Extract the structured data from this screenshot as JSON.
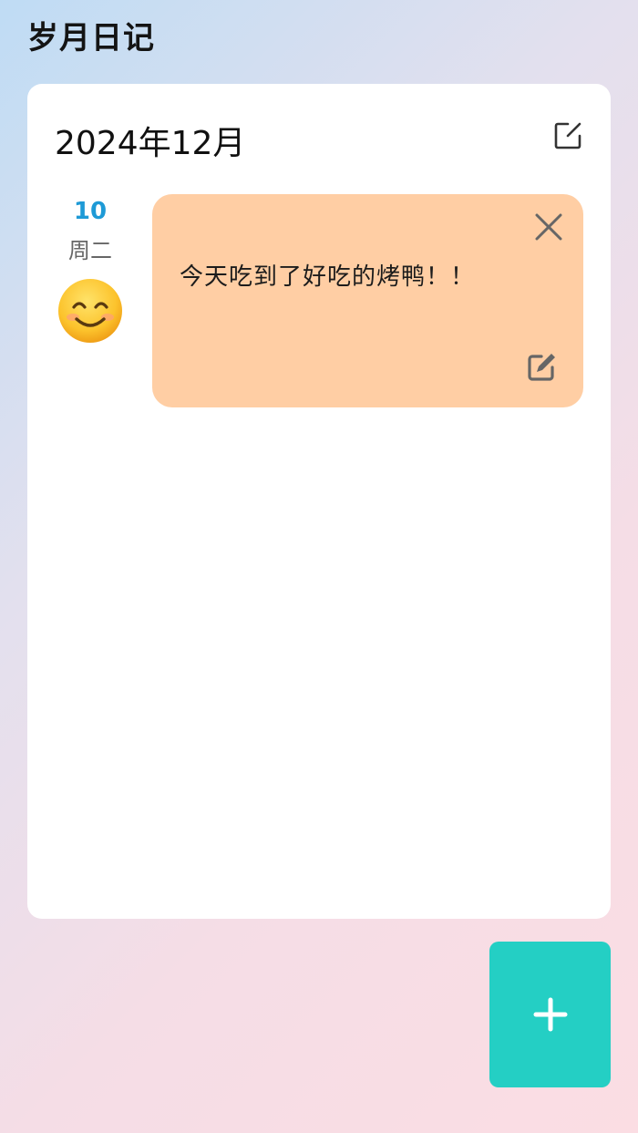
{
  "app": {
    "title": "岁月日记"
  },
  "diary": {
    "month_title": "2024年12月",
    "edit_icon": "edit-square-icon",
    "entries": [
      {
        "day": "10",
        "weekday": "周二",
        "mood_icon": "smiling-face-emoji",
        "text": "今天吃到了好吃的烤鸭！！",
        "note_color": "#ffcea4",
        "close_icon": "close-icon",
        "edit_icon": "pencil-square-icon"
      }
    ]
  },
  "fab": {
    "icon": "plus-icon",
    "color": "#24cfc4"
  },
  "colors": {
    "accent_day": "#1e9ad6",
    "card": "#ffffff"
  }
}
